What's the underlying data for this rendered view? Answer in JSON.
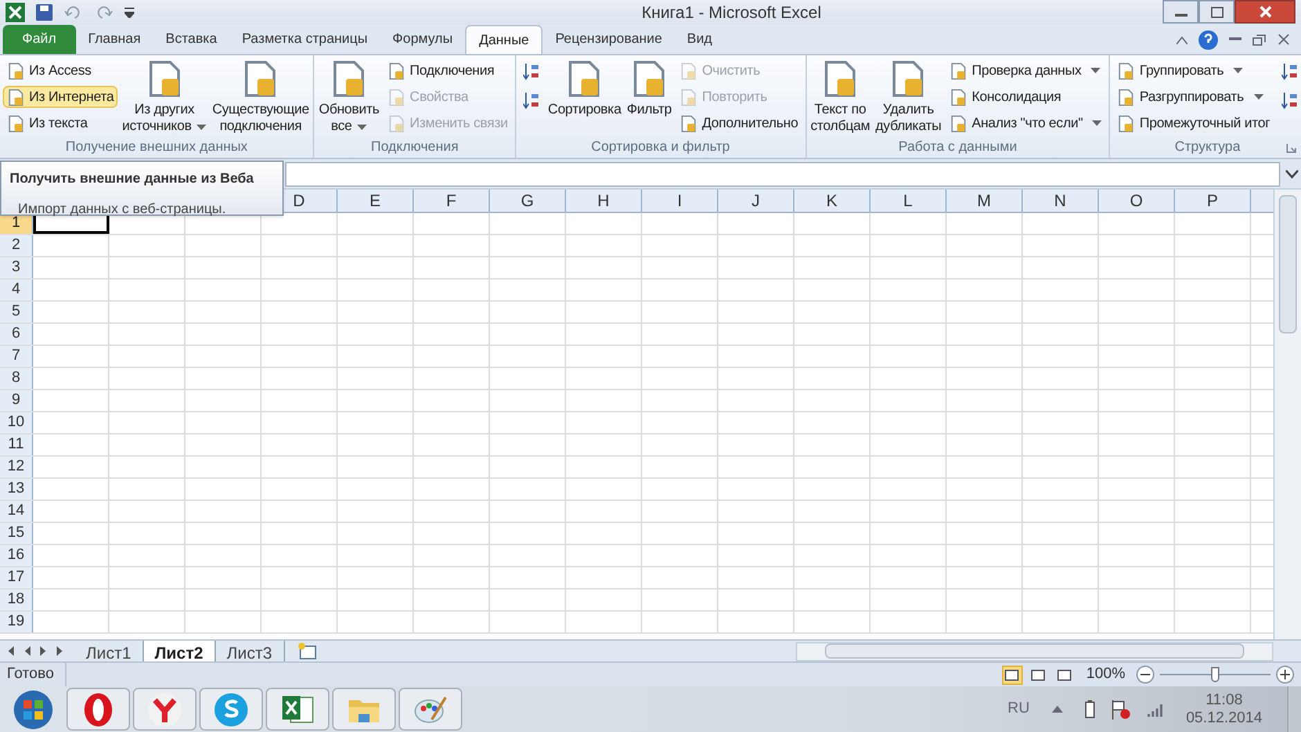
{
  "window": {
    "title": "Книга1 - Microsoft Excel"
  },
  "tabs": [
    {
      "label": "Файл",
      "kind": "file",
      "selected": false
    },
    {
      "label": "Главная",
      "kind": "tab",
      "selected": false
    },
    {
      "label": "Вставка",
      "kind": "tab",
      "selected": false
    },
    {
      "label": "Разметка страницы",
      "kind": "tab",
      "selected": false
    },
    {
      "label": "Формулы",
      "kind": "tab",
      "selected": false
    },
    {
      "label": "Данные",
      "kind": "tab",
      "selected": true
    },
    {
      "label": "Рецензирование",
      "kind": "tab",
      "selected": false
    },
    {
      "label": "Вид",
      "kind": "tab",
      "selected": false
    }
  ],
  "ribbon": {
    "groups": [
      {
        "label": "Получение внешних данных",
        "launcher": false,
        "columns": [
          {
            "kind": "stack",
            "items": [
              {
                "kind": "small",
                "label": "Из Access",
                "dropdown": false,
                "disabled": false,
                "highlighted": false
              },
              {
                "kind": "small",
                "label": "Из Интернета",
                "dropdown": false,
                "disabled": false,
                "highlighted": true
              },
              {
                "kind": "small",
                "label": "Из текста",
                "dropdown": false,
                "disabled": false,
                "highlighted": false
              }
            ]
          },
          {
            "kind": "large",
            "lines": [
              "Из других",
              "источников"
            ],
            "dropdown": true
          },
          {
            "kind": "large",
            "lines": [
              "Существующие",
              "подключения"
            ],
            "dropdown": false
          }
        ]
      },
      {
        "label": "Подключения",
        "launcher": false,
        "columns": [
          {
            "kind": "large",
            "lines": [
              "Обновить",
              "все"
            ],
            "dropdown": true
          },
          {
            "kind": "stack",
            "items": [
              {
                "kind": "small",
                "label": "Подключения",
                "dropdown": false,
                "disabled": false,
                "highlighted": false
              },
              {
                "kind": "small",
                "label": "Свойства",
                "dropdown": false,
                "disabled": true,
                "highlighted": false
              },
              {
                "kind": "small",
                "label": "Изменить связи",
                "dropdown": false,
                "disabled": true,
                "highlighted": false
              }
            ]
          }
        ]
      },
      {
        "label": "Сортировка и фильтр",
        "launcher": false,
        "columns": [
          {
            "kind": "stack",
            "items": [
              {
                "kind": "icon",
                "disabled": false
              },
              {
                "kind": "icon",
                "disabled": false
              }
            ]
          },
          {
            "kind": "large",
            "lines": [
              "Сортировка"
            ],
            "dropdown": false
          },
          {
            "kind": "large",
            "lines": [
              "Фильтр"
            ],
            "dropdown": false
          },
          {
            "kind": "stack",
            "items": [
              {
                "kind": "small",
                "label": "Очистить",
                "dropdown": false,
                "disabled": true,
                "highlighted": false
              },
              {
                "kind": "small",
                "label": "Повторить",
                "dropdown": false,
                "disabled": true,
                "highlighted": false
              },
              {
                "kind": "small",
                "label": "Дополнительно",
                "dropdown": false,
                "disabled": false,
                "highlighted": false
              }
            ]
          }
        ]
      },
      {
        "label": "Работа с данными",
        "launcher": false,
        "columns": [
          {
            "kind": "large",
            "lines": [
              "Текст по",
              "столбцам"
            ],
            "dropdown": false
          },
          {
            "kind": "large",
            "lines": [
              "Удалить",
              "дубликаты"
            ],
            "dropdown": false
          },
          {
            "kind": "stack",
            "items": [
              {
                "kind": "small",
                "label": "Проверка данных",
                "dropdown": true,
                "disabled": false,
                "highlighted": false
              },
              {
                "kind": "small",
                "label": "Консолидация",
                "dropdown": false,
                "disabled": false,
                "highlighted": false
              },
              {
                "kind": "small",
                "label": "Анализ \"что если\"",
                "dropdown": true,
                "disabled": false,
                "highlighted": false
              }
            ]
          }
        ]
      },
      {
        "label": "Структура",
        "launcher": true,
        "columns": [
          {
            "kind": "stack",
            "items": [
              {
                "kind": "small",
                "label": "Группировать",
                "dropdown": true,
                "disabled": false,
                "highlighted": false
              },
              {
                "kind": "small",
                "label": "Разгруппировать",
                "dropdown": true,
                "disabled": false,
                "highlighted": false
              },
              {
                "kind": "small",
                "label": "Промежуточный итог",
                "dropdown": false,
                "disabled": false,
                "highlighted": false
              }
            ]
          },
          {
            "kind": "stack",
            "items": [
              {
                "kind": "icon",
                "disabled": false
              },
              {
                "kind": "icon",
                "disabled": false
              }
            ]
          }
        ]
      }
    ]
  },
  "tooltip": {
    "title": "Получить внешние данные из Веба",
    "text": "Импорт данных с веб-страницы."
  },
  "grid": {
    "columns": [
      "D",
      "E",
      "F",
      "G",
      "H",
      "I",
      "J",
      "K",
      "L",
      "M",
      "N",
      "O",
      "P"
    ],
    "rows": [
      {
        "label": "1",
        "selected": true
      },
      {
        "label": "2",
        "selected": false
      },
      {
        "label": "3",
        "selected": false
      },
      {
        "label": "4",
        "selected": false
      },
      {
        "label": "5",
        "selected": false
      },
      {
        "label": "6",
        "selected": false
      },
      {
        "label": "7",
        "selected": false
      },
      {
        "label": "8",
        "selected": false
      },
      {
        "label": "9",
        "selected": false
      },
      {
        "label": "10",
        "selected": false
      },
      {
        "label": "11",
        "selected": false
      },
      {
        "label": "12",
        "selected": false
      },
      {
        "label": "13",
        "selected": false
      },
      {
        "label": "14",
        "selected": false
      },
      {
        "label": "15",
        "selected": false
      },
      {
        "label": "16",
        "selected": false
      },
      {
        "label": "17",
        "selected": false
      },
      {
        "label": "18",
        "selected": false
      },
      {
        "label": "19",
        "selected": false
      }
    ]
  },
  "sheets": [
    {
      "label": "Лист1",
      "selected": false
    },
    {
      "label": "Лист2",
      "selected": true
    },
    {
      "label": "Лист3",
      "selected": false
    }
  ],
  "status_bar": {
    "text": "Готово",
    "views": [
      {
        "selected": true
      },
      {
        "selected": false
      },
      {
        "selected": false
      }
    ],
    "zoom": "100%",
    "zoom_level": {
      "level": 0.5
    }
  },
  "taskbar": {
    "apps": [
      {
        "kind": "opera"
      },
      {
        "kind": "yandex"
      },
      {
        "kind": "skype"
      },
      {
        "kind": "excel"
      },
      {
        "kind": "explorer"
      },
      {
        "kind": "paint"
      }
    ],
    "language": "RU",
    "time": "11:08",
    "date": "05.12.2014"
  }
}
